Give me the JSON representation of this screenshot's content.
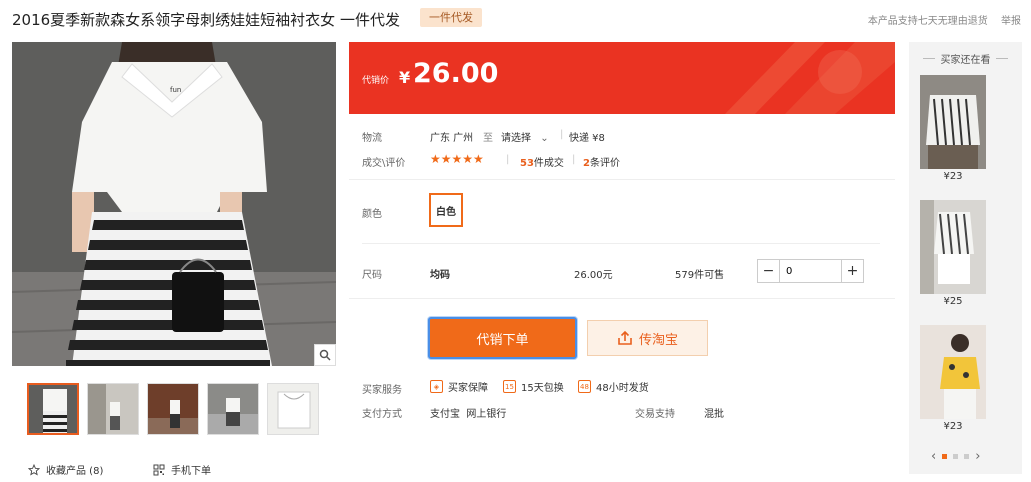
{
  "product": {
    "title": "2016夏季新款森女系领字母刺绣娃娃短袖衬衣女 一件代发",
    "badge": "一件代发"
  },
  "top_links": {
    "return_policy": "本产品支持七天无理由退货",
    "report": "举报"
  },
  "price": {
    "label": "代销价",
    "currency": "¥",
    "value": "26.00"
  },
  "logistics": {
    "label": "物流",
    "from": "广东 广州",
    "to_word": "至",
    "destination_select": "请选择",
    "express": "快递 ¥8"
  },
  "deals": {
    "label": "成交\\评价",
    "stars": "★★★★★",
    "sold_count": "53",
    "sold_suffix": "件成交",
    "review_count": "2",
    "review_suffix": "条评价"
  },
  "color": {
    "label": "颜色",
    "selected": "白色"
  },
  "size": {
    "label": "尺码",
    "value": "均码",
    "unit_price": "26.00元",
    "stock": "579件可售",
    "quantity": "0",
    "minus": "−",
    "plus": "+"
  },
  "actions": {
    "order": "代销下单",
    "taobao": "传淘宝"
  },
  "services": {
    "label": "买家服务",
    "items": [
      "买家保障",
      "15天包换",
      "48小时发货"
    ],
    "icons": [
      "shield-icon",
      "15-days-icon",
      "48-hours-icon"
    ]
  },
  "payment": {
    "label": "支付方式",
    "methods": "支付宝  网上银行",
    "trade_label": "交易支持",
    "trade_value": "混批"
  },
  "bottom_links": {
    "favorite": "收藏产品 (8)",
    "mobile": "手机下单"
  },
  "side": {
    "header": "买家还在看",
    "items": [
      {
        "price": "¥23"
      },
      {
        "price": "¥25"
      },
      {
        "price": "¥23"
      }
    ],
    "prev": "‹",
    "next": "›"
  },
  "colors": {
    "accent": "#f06a19",
    "price_bg": "#ea3322",
    "order_border": "#4a8ee6"
  }
}
